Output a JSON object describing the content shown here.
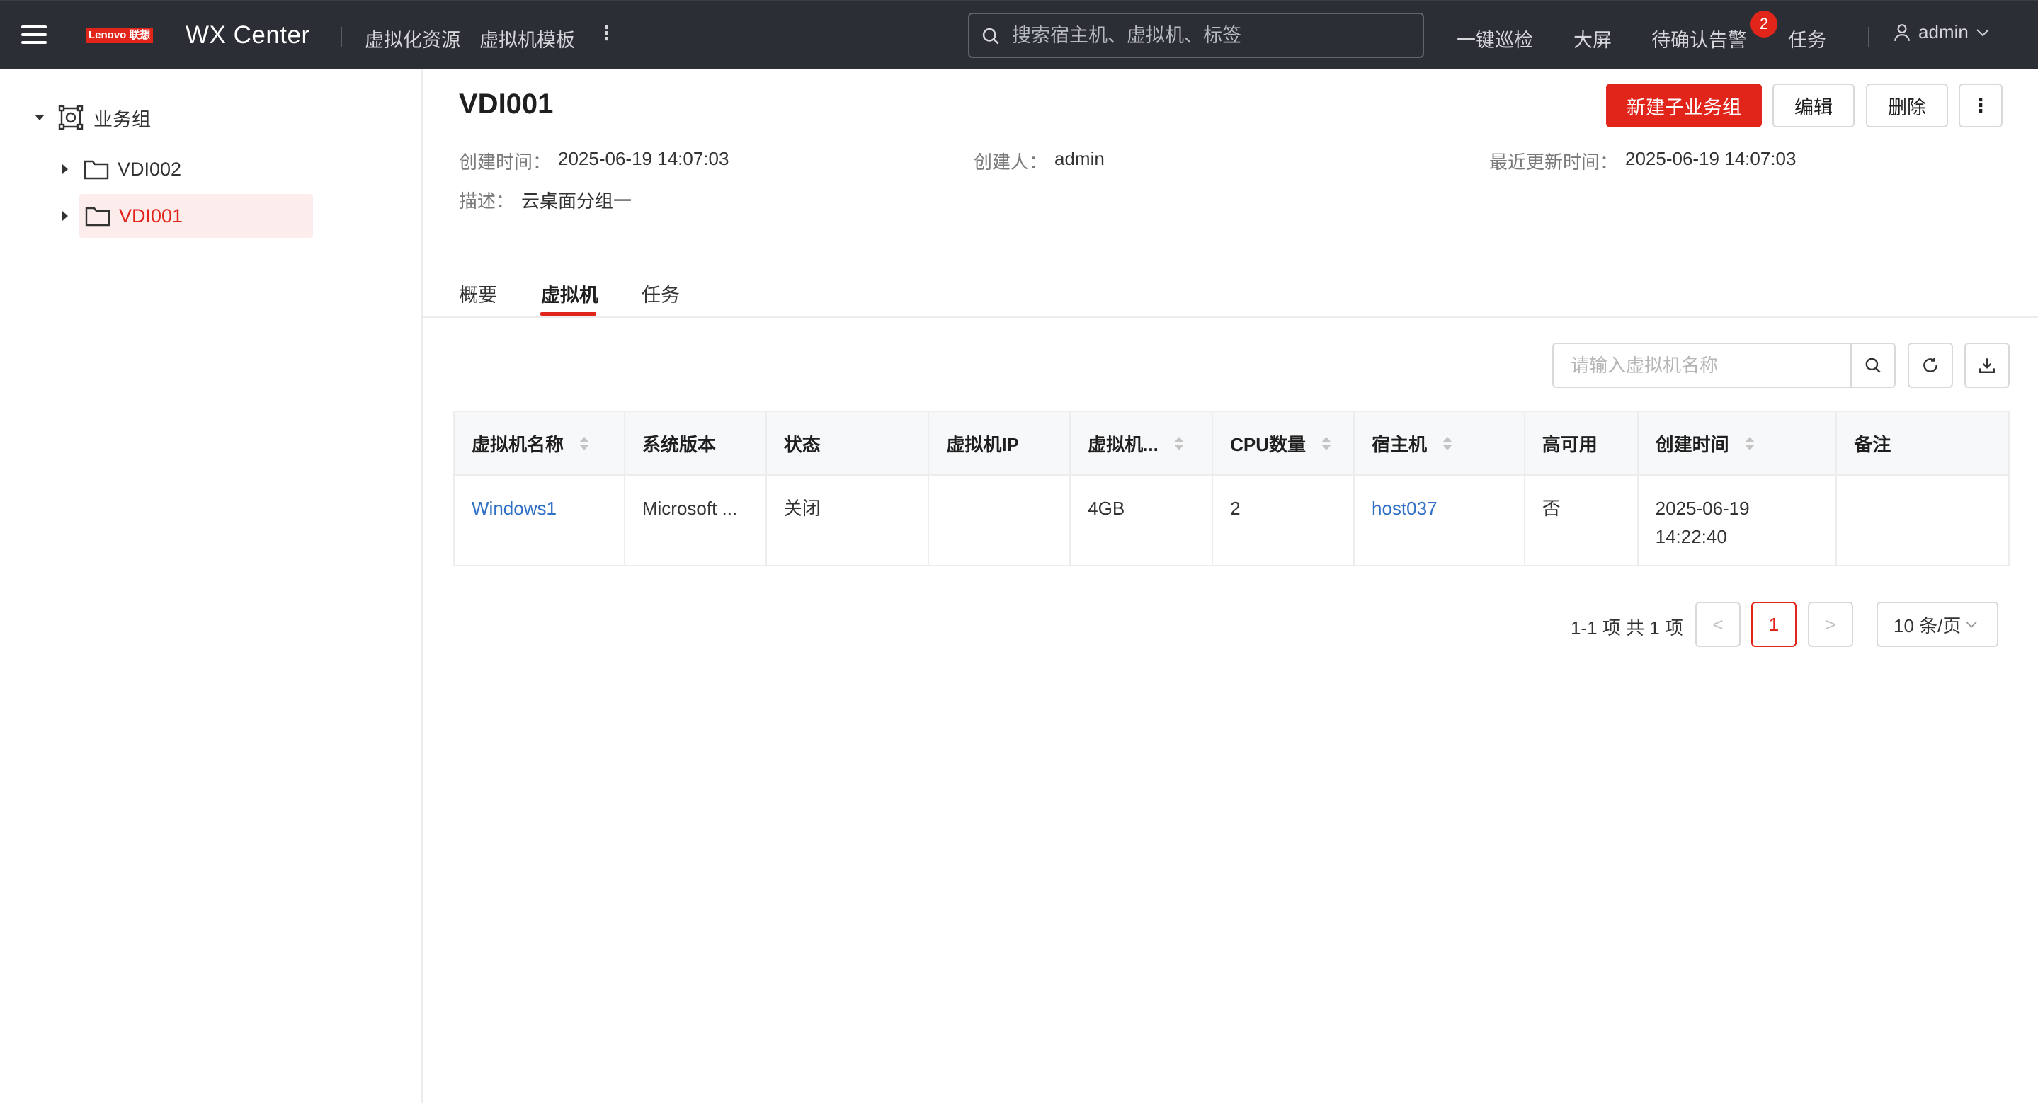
{
  "header": {
    "brand": {
      "latin": "Lenovo",
      "cn": "联想"
    },
    "title": "WX Center",
    "nav": [
      {
        "label": "虚拟化资源"
      },
      {
        "label": "虚拟机模板"
      }
    ],
    "more": "⋮",
    "search_placeholder": "搜索宿主机、虚拟机、标签",
    "actions": {
      "inspect": "一键巡检",
      "screen": "大屏",
      "alerts": "待确认告警",
      "alerts_count": "2",
      "tasks": "任务"
    },
    "user": "admin"
  },
  "sidebar": {
    "root": {
      "label": "业务组"
    },
    "items": [
      {
        "label": "VDI002",
        "selected": false
      },
      {
        "label": "VDI001",
        "selected": true
      }
    ]
  },
  "group": {
    "title": "VDI001",
    "buttons": {
      "new_sub": "新建子业务组",
      "edit": "编辑",
      "delete": "删除",
      "more": "⋮"
    },
    "meta": {
      "created_label": "创建时间：",
      "created_value": "2025-06-19 14:07:03",
      "creator_label": "创建人：",
      "creator_value": "admin",
      "updated_label": "最近更新时间：",
      "updated_value": "2025-06-19 14:07:03",
      "desc_label": "描述：",
      "desc_value": "云桌面分组一"
    }
  },
  "tabs": [
    {
      "label": "概要",
      "active": false
    },
    {
      "label": "虚拟机",
      "active": true
    },
    {
      "label": "任务",
      "active": false
    }
  ],
  "vm_search": {
    "placeholder": "请输入虚拟机名称"
  },
  "table": {
    "columns": [
      {
        "label": "虚拟机名称",
        "sortable": true
      },
      {
        "label": "系统版本",
        "sortable": false
      },
      {
        "label": "状态",
        "sortable": false
      },
      {
        "label": "虚拟机IP",
        "sortable": false
      },
      {
        "label": "虚拟机...",
        "sortable": true
      },
      {
        "label": "CPU数量",
        "sortable": true
      },
      {
        "label": "宿主机",
        "sortable": true
      },
      {
        "label": "高可用",
        "sortable": false
      },
      {
        "label": "创建时间",
        "sortable": true
      },
      {
        "label": "备注",
        "sortable": false
      }
    ],
    "rows": [
      {
        "name": "Windows1",
        "os": "Microsoft ...",
        "status": "关闭",
        "ip": "",
        "memory": "4GB",
        "cpu": "2",
        "host": "host037",
        "ha": "否",
        "created_date": "2025-06-19",
        "created_time": "14:22:40",
        "note": ""
      }
    ]
  },
  "pagination": {
    "total_text": "1-1 项 共 1 项",
    "prev": "<",
    "current": "1",
    "next": ">",
    "page_size": "10 条/页"
  },
  "colors": {
    "accent": "#e1251b",
    "topbar": "#2b2e35",
    "link": "#2f6fc6"
  }
}
